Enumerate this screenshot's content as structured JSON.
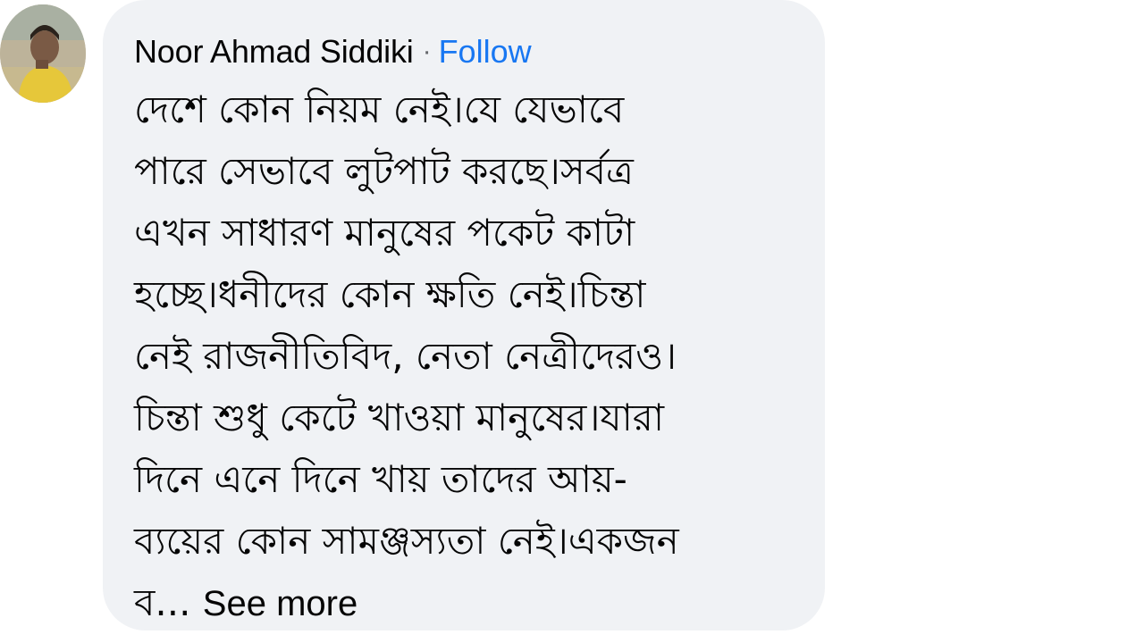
{
  "comment": {
    "author": "Noor Ahmad Siddiki",
    "separator": "·",
    "follow_label": "Follow",
    "lines": [
      "দেশে কোন নিয়ম নেই।যে যেভাবে",
      "পারে সেভাবে লুটপাট করছে।সর্বত্র",
      "এখন সাধারণ মানুষের পকেট কাটা",
      "হচ্ছে।ধনীদের কোন ক্ষতি নেই।চিন্তা",
      "নেই রাজনীতিবিদ, নেতা নেত্রীদেরও।",
      "চিন্তা শুধু কেটে খাওয়া মানুষের।যারা",
      "দিনে এনে দিনে খায় তাদের আয়-",
      "ব্যয়ের কোন সামঞ্জস্যতা নেই।একজন"
    ],
    "last_line_prefix": "ব...",
    "see_more_label": "See more"
  },
  "colors": {
    "bubble_bg": "#f0f2f5",
    "text": "#050505",
    "link": "#1877f2",
    "muted": "#65676b"
  },
  "icons": {
    "avatar": "profile-photo"
  }
}
